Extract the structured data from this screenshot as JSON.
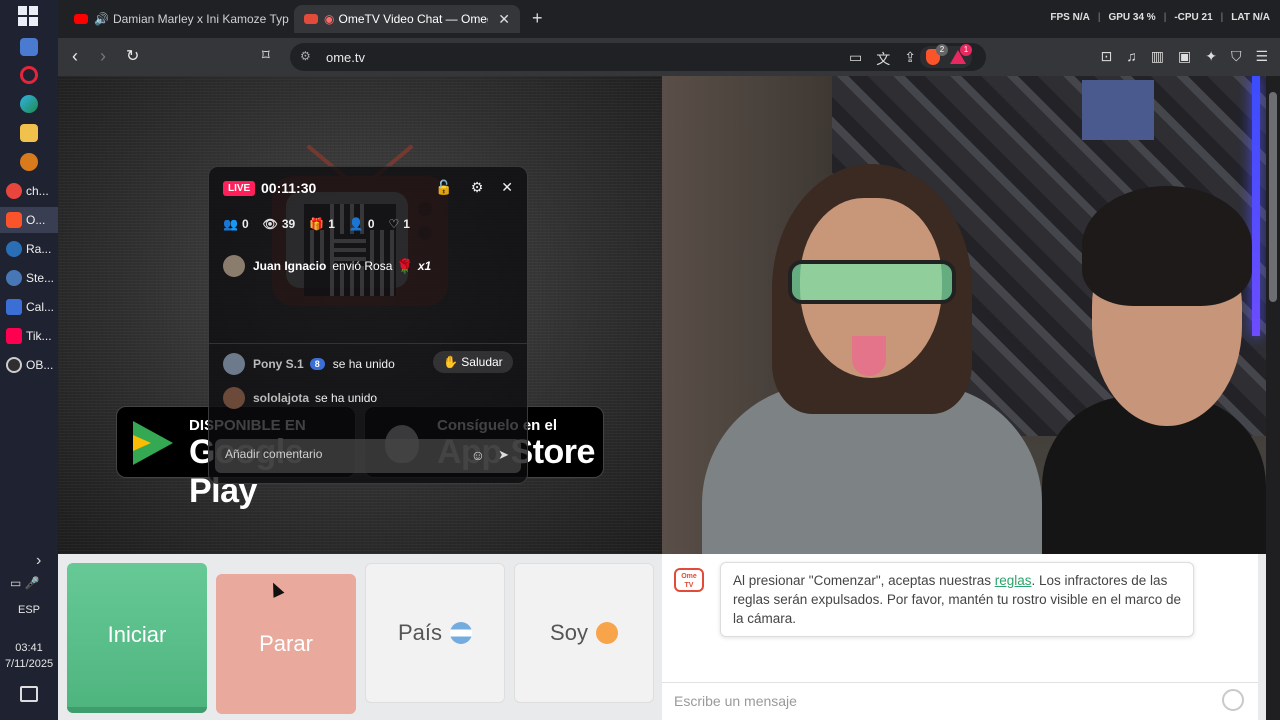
{
  "taskbar": {
    "apps": [
      {
        "label": "ch...",
        "icon": "chrome-icon",
        "color": "#e8453c"
      },
      {
        "label": "O...",
        "icon": "brave-icon",
        "color": "#fb542b",
        "active": true
      },
      {
        "label": "Ra...",
        "icon": "steam-icon",
        "color": "#2a6fb5"
      },
      {
        "label": "Ste...",
        "icon": "steam-icon",
        "color": "#1b2838"
      },
      {
        "label": "Cal...",
        "icon": "calculator-icon",
        "color": "#3b6fd6"
      },
      {
        "label": "Tik...",
        "icon": "tiktok-icon",
        "color": "#ff0050"
      },
      {
        "label": "OB...",
        "icon": "obs-icon",
        "color": "#302e31"
      }
    ],
    "language": "ESP",
    "time": "03:41",
    "date": "7/11/2025"
  },
  "tabs": [
    {
      "title": "Damian Marley x Ini Kamoze Typ",
      "icon": "youtube-icon"
    },
    {
      "title": "OmeTV Video Chat — Omegl",
      "icon": "ometv-icon",
      "active": true
    }
  ],
  "sysinfo": {
    "fps_label": "FPS",
    "fps_value": "N/A",
    "gpu_label": "GPU",
    "gpu_value": "34 %",
    "cpu_label": "-CPU",
    "cpu_value": "21",
    "lat_label": "LAT",
    "lat_value": "N/A"
  },
  "toolbar": {
    "url": "ome.tv",
    "shields_count": "2",
    "rewards_count": "1"
  },
  "live": {
    "badge": "LIVE",
    "timer": "00:11:30",
    "stats": {
      "followers": "0",
      "viewers": "39",
      "gifts": "1",
      "members": "0",
      "likes": "1"
    },
    "gift": {
      "user": "Juan Ignacio",
      "action": "envió Rosa",
      "count": "x1"
    },
    "joins": [
      {
        "user": "Pony S.1",
        "level": "8",
        "text": "se ha unido"
      },
      {
        "user": "sololajota",
        "text": "se ha unido"
      }
    ],
    "greet_label": "Saludar",
    "comment_placeholder": "Añadir comentario"
  },
  "stores": {
    "google_small": "DISPONIBLE EN",
    "google_big": "Google Play",
    "apple_small": "Consíguelo en el",
    "apple_big": "App Store"
  },
  "controls": {
    "start": "Iniciar",
    "stop": "Parar",
    "country": "País",
    "me": "Soy"
  },
  "chat": {
    "logo_text": "Ome TV",
    "notice_before": "Al presionar \"Comenzar\", aceptas nuestras ",
    "notice_link": "reglas",
    "notice_after": ". Los infractores de las reglas serán expulsados. Por favor, mantén tu rostro visible en el marco de la cámara.",
    "input_placeholder": "Escribe un mensaje"
  },
  "colors": {
    "start_green": "#5bbf8a",
    "stop_salmon": "#e9a99c",
    "live_red": "#ff1f5a",
    "link_green": "#2fa36b"
  }
}
